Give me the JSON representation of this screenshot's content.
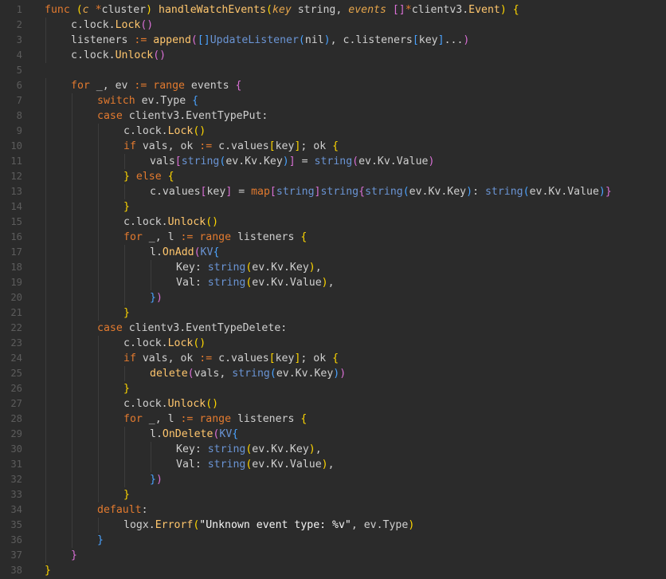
{
  "colors": {
    "background": "#2b2b2b",
    "line_number": "#5c5c5c",
    "plain": "#cfcfcf",
    "keyword": "#e27a2f",
    "function": "#ffc66d",
    "type": "#6a94d4",
    "bracket_gold": "#ffd700",
    "bracket_purple": "#da70d6",
    "bracket_blue": "#4aa3ff"
  },
  "editor": {
    "lines": [
      {
        "n": "1",
        "indent": 0,
        "tokens": [
          [
            "kw",
            "func"
          ],
          [
            "plain",
            " "
          ],
          [
            "brk1",
            "("
          ],
          [
            "param",
            "c"
          ],
          [
            "plain",
            " "
          ],
          [
            "op",
            "*"
          ],
          [
            "plain",
            "cluster"
          ],
          [
            "brk1",
            ")"
          ],
          [
            "plain",
            " "
          ],
          [
            "fn",
            "handleWatchEvents"
          ],
          [
            "brk1",
            "("
          ],
          [
            "param",
            "key"
          ],
          [
            "plain",
            " "
          ],
          [
            "plain",
            "string"
          ],
          [
            "plain",
            ", "
          ],
          [
            "param",
            "events"
          ],
          [
            "plain",
            " "
          ],
          [
            "brk2",
            "[]"
          ],
          [
            "op",
            "*"
          ],
          [
            "plain",
            "clientv3."
          ],
          [
            "fn",
            "Event"
          ],
          [
            "brk1",
            ")"
          ],
          [
            "plain",
            " "
          ],
          [
            "brk1",
            "{"
          ]
        ]
      },
      {
        "n": "2",
        "indent": 1,
        "tokens": [
          [
            "plain",
            "c.lock."
          ],
          [
            "call",
            "Lock"
          ],
          [
            "brk2",
            "()"
          ]
        ]
      },
      {
        "n": "3",
        "indent": 1,
        "tokens": [
          [
            "plain",
            "listeners "
          ],
          [
            "op",
            ":="
          ],
          [
            "plain",
            " "
          ],
          [
            "call",
            "append"
          ],
          [
            "brk2",
            "("
          ],
          [
            "brk3",
            "[]"
          ],
          [
            "type",
            "UpdateListener"
          ],
          [
            "brk3",
            "("
          ],
          [
            "plain",
            "nil"
          ],
          [
            "brk3",
            ")"
          ],
          [
            "plain",
            ", c.listeners"
          ],
          [
            "brk3",
            "["
          ],
          [
            "plain",
            "key"
          ],
          [
            "brk3",
            "]"
          ],
          [
            "plain",
            "..."
          ],
          [
            "brk2",
            ")"
          ]
        ]
      },
      {
        "n": "4",
        "indent": 1,
        "tokens": [
          [
            "plain",
            "c.lock."
          ],
          [
            "call",
            "Unlock"
          ],
          [
            "brk2",
            "()"
          ]
        ]
      },
      {
        "n": "5",
        "indent": 0,
        "tokens": []
      },
      {
        "n": "6",
        "indent": 1,
        "tokens": [
          [
            "kw",
            "for"
          ],
          [
            "plain",
            " _, ev "
          ],
          [
            "op",
            ":="
          ],
          [
            "plain",
            " "
          ],
          [
            "kw",
            "range"
          ],
          [
            "plain",
            " events "
          ],
          [
            "brk2",
            "{"
          ]
        ]
      },
      {
        "n": "7",
        "indent": 2,
        "tokens": [
          [
            "kw",
            "switch"
          ],
          [
            "plain",
            " ev.Type "
          ],
          [
            "brk3",
            "{"
          ]
        ]
      },
      {
        "n": "8",
        "indent": 2,
        "tokens": [
          [
            "kw",
            "case"
          ],
          [
            "plain",
            " clientv3.EventTypePut:"
          ]
        ]
      },
      {
        "n": "9",
        "indent": 3,
        "tokens": [
          [
            "plain",
            "c.lock."
          ],
          [
            "call",
            "Lock"
          ],
          [
            "brk1",
            "()"
          ]
        ]
      },
      {
        "n": "10",
        "indent": 3,
        "tokens": [
          [
            "kw",
            "if"
          ],
          [
            "plain",
            " vals, ok "
          ],
          [
            "op",
            ":="
          ],
          [
            "plain",
            " c.values"
          ],
          [
            "brk1",
            "["
          ],
          [
            "plain",
            "key"
          ],
          [
            "brk1",
            "]"
          ],
          [
            "plain",
            "; ok "
          ],
          [
            "brk1",
            "{"
          ]
        ]
      },
      {
        "n": "11",
        "indent": 4,
        "tokens": [
          [
            "plain",
            "vals"
          ],
          [
            "brk2",
            "["
          ],
          [
            "builtin",
            "string"
          ],
          [
            "brk3",
            "("
          ],
          [
            "plain",
            "ev.Kv.Key"
          ],
          [
            "brk3",
            ")"
          ],
          [
            "brk2",
            "]"
          ],
          [
            "plain",
            " = "
          ],
          [
            "builtin",
            "string"
          ],
          [
            "brk2",
            "("
          ],
          [
            "plain",
            "ev.Kv.Value"
          ],
          [
            "brk2",
            ")"
          ]
        ]
      },
      {
        "n": "12",
        "indent": 3,
        "tokens": [
          [
            "brk1",
            "}"
          ],
          [
            "plain",
            " "
          ],
          [
            "kw",
            "else"
          ],
          [
            "plain",
            " "
          ],
          [
            "brk1",
            "{"
          ]
        ]
      },
      {
        "n": "13",
        "indent": 4,
        "tokens": [
          [
            "plain",
            "c.values"
          ],
          [
            "brk2",
            "["
          ],
          [
            "plain",
            "key"
          ],
          [
            "brk2",
            "]"
          ],
          [
            "plain",
            " = "
          ],
          [
            "kw",
            "map"
          ],
          [
            "brk2",
            "["
          ],
          [
            "builtin",
            "string"
          ],
          [
            "brk2",
            "]"
          ],
          [
            "builtin",
            "string"
          ],
          [
            "brk2",
            "{"
          ],
          [
            "builtin",
            "string"
          ],
          [
            "brk3",
            "("
          ],
          [
            "plain",
            "ev.Kv.Key"
          ],
          [
            "brk3",
            ")"
          ],
          [
            "plain",
            ": "
          ],
          [
            "builtin",
            "string"
          ],
          [
            "brk3",
            "("
          ],
          [
            "plain",
            "ev.Kv.Value"
          ],
          [
            "brk3",
            ")"
          ],
          [
            "brk2",
            "}"
          ]
        ]
      },
      {
        "n": "14",
        "indent": 3,
        "tokens": [
          [
            "brk1",
            "}"
          ]
        ]
      },
      {
        "n": "15",
        "indent": 3,
        "tokens": [
          [
            "plain",
            "c.lock."
          ],
          [
            "call",
            "Unlock"
          ],
          [
            "brk1",
            "()"
          ]
        ]
      },
      {
        "n": "16",
        "indent": 3,
        "tokens": [
          [
            "kw",
            "for"
          ],
          [
            "plain",
            " _, l "
          ],
          [
            "op",
            ":="
          ],
          [
            "plain",
            " "
          ],
          [
            "kw",
            "range"
          ],
          [
            "plain",
            " listeners "
          ],
          [
            "brk1",
            "{"
          ]
        ]
      },
      {
        "n": "17",
        "indent": 4,
        "tokens": [
          [
            "plain",
            "l."
          ],
          [
            "call",
            "OnAdd"
          ],
          [
            "brk2",
            "("
          ],
          [
            "type",
            "KV"
          ],
          [
            "brk3",
            "{"
          ]
        ]
      },
      {
        "n": "18",
        "indent": 5,
        "tokens": [
          [
            "plain",
            "Key: "
          ],
          [
            "builtin",
            "string"
          ],
          [
            "brk1",
            "("
          ],
          [
            "plain",
            "ev.Kv.Key"
          ],
          [
            "brk1",
            ")"
          ],
          [
            "plain",
            ","
          ]
        ]
      },
      {
        "n": "19",
        "indent": 5,
        "tokens": [
          [
            "plain",
            "Val: "
          ],
          [
            "builtin",
            "string"
          ],
          [
            "brk1",
            "("
          ],
          [
            "plain",
            "ev.Kv.Value"
          ],
          [
            "brk1",
            ")"
          ],
          [
            "plain",
            ","
          ]
        ]
      },
      {
        "n": "20",
        "indent": 4,
        "tokens": [
          [
            "brk3",
            "}"
          ],
          [
            "brk2",
            ")"
          ]
        ]
      },
      {
        "n": "21",
        "indent": 3,
        "tokens": [
          [
            "brk1",
            "}"
          ]
        ]
      },
      {
        "n": "22",
        "indent": 2,
        "tokens": [
          [
            "kw",
            "case"
          ],
          [
            "plain",
            " clientv3.EventTypeDelete:"
          ]
        ]
      },
      {
        "n": "23",
        "indent": 3,
        "tokens": [
          [
            "plain",
            "c.lock."
          ],
          [
            "call",
            "Lock"
          ],
          [
            "brk1",
            "()"
          ]
        ]
      },
      {
        "n": "24",
        "indent": 3,
        "tokens": [
          [
            "kw",
            "if"
          ],
          [
            "plain",
            " vals, ok "
          ],
          [
            "op",
            ":="
          ],
          [
            "plain",
            " c.values"
          ],
          [
            "brk1",
            "["
          ],
          [
            "plain",
            "key"
          ],
          [
            "brk1",
            "]"
          ],
          [
            "plain",
            "; ok "
          ],
          [
            "brk1",
            "{"
          ]
        ]
      },
      {
        "n": "25",
        "indent": 4,
        "tokens": [
          [
            "call",
            "delete"
          ],
          [
            "brk2",
            "("
          ],
          [
            "plain",
            "vals, "
          ],
          [
            "builtin",
            "string"
          ],
          [
            "brk3",
            "("
          ],
          [
            "plain",
            "ev.Kv.Key"
          ],
          [
            "brk3",
            ")"
          ],
          [
            "brk2",
            ")"
          ]
        ]
      },
      {
        "n": "26",
        "indent": 3,
        "tokens": [
          [
            "brk1",
            "}"
          ]
        ]
      },
      {
        "n": "27",
        "indent": 3,
        "tokens": [
          [
            "plain",
            "c.lock."
          ],
          [
            "call",
            "Unlock"
          ],
          [
            "brk1",
            "()"
          ]
        ]
      },
      {
        "n": "28",
        "indent": 3,
        "tokens": [
          [
            "kw",
            "for"
          ],
          [
            "plain",
            " _, l "
          ],
          [
            "op",
            ":="
          ],
          [
            "plain",
            " "
          ],
          [
            "kw",
            "range"
          ],
          [
            "plain",
            " listeners "
          ],
          [
            "brk1",
            "{"
          ]
        ]
      },
      {
        "n": "29",
        "indent": 4,
        "tokens": [
          [
            "plain",
            "l."
          ],
          [
            "call",
            "OnDelete"
          ],
          [
            "brk2",
            "("
          ],
          [
            "type",
            "KV"
          ],
          [
            "brk3",
            "{"
          ]
        ]
      },
      {
        "n": "30",
        "indent": 5,
        "tokens": [
          [
            "plain",
            "Key: "
          ],
          [
            "builtin",
            "string"
          ],
          [
            "brk1",
            "("
          ],
          [
            "plain",
            "ev.Kv.Key"
          ],
          [
            "brk1",
            ")"
          ],
          [
            "plain",
            ","
          ]
        ]
      },
      {
        "n": "31",
        "indent": 5,
        "tokens": [
          [
            "plain",
            "Val: "
          ],
          [
            "builtin",
            "string"
          ],
          [
            "brk1",
            "("
          ],
          [
            "plain",
            "ev.Kv.Value"
          ],
          [
            "brk1",
            ")"
          ],
          [
            "plain",
            ","
          ]
        ]
      },
      {
        "n": "32",
        "indent": 4,
        "tokens": [
          [
            "brk3",
            "}"
          ],
          [
            "brk2",
            ")"
          ]
        ]
      },
      {
        "n": "33",
        "indent": 3,
        "tokens": [
          [
            "brk1",
            "}"
          ]
        ]
      },
      {
        "n": "34",
        "indent": 2,
        "tokens": [
          [
            "kw",
            "default"
          ],
          [
            "plain",
            ":"
          ]
        ]
      },
      {
        "n": "35",
        "indent": 3,
        "tokens": [
          [
            "plain",
            "logx."
          ],
          [
            "call",
            "Errorf"
          ],
          [
            "brk1",
            "("
          ],
          [
            "str",
            "\"Unknown event type: %v\""
          ],
          [
            "plain",
            ", ev.Type"
          ],
          [
            "brk1",
            ")"
          ]
        ]
      },
      {
        "n": "36",
        "indent": 2,
        "tokens": [
          [
            "brk3",
            "}"
          ]
        ]
      },
      {
        "n": "37",
        "indent": 1,
        "tokens": [
          [
            "brk2",
            "}"
          ]
        ]
      },
      {
        "n": "38",
        "indent": 0,
        "tokens": [
          [
            "brk1",
            "}"
          ]
        ]
      }
    ]
  }
}
